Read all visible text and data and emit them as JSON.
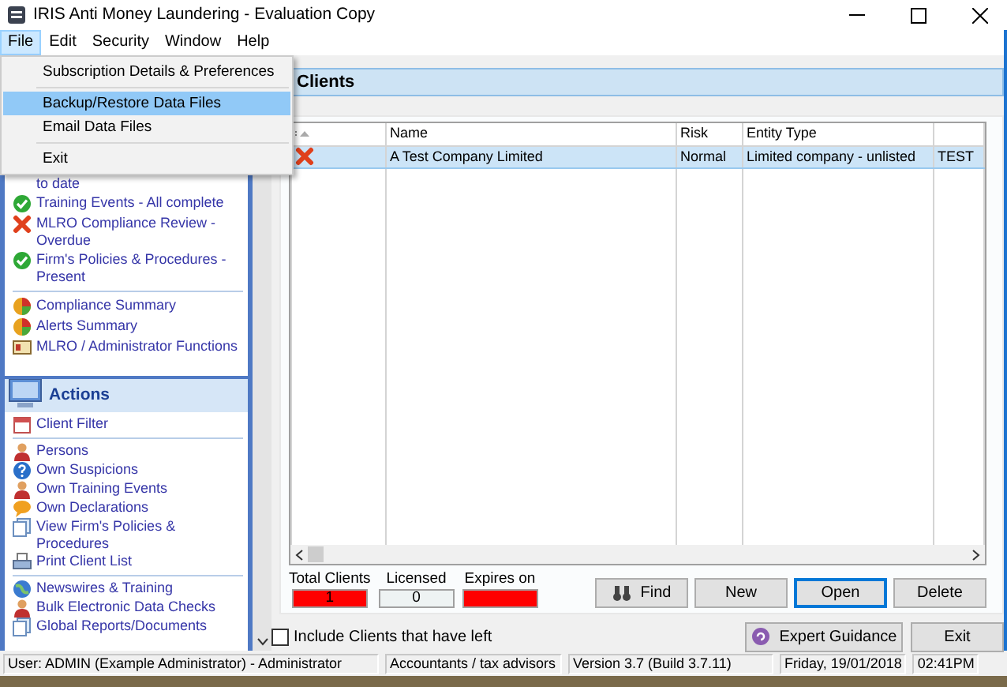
{
  "window": {
    "title": "IRIS Anti Money Laundering - Evaluation Copy"
  },
  "menu_bar": [
    {
      "label": "File",
      "selected": true
    },
    {
      "label": "Edit",
      "selected": false
    },
    {
      "label": "Security",
      "selected": false
    },
    {
      "label": "Window",
      "selected": false
    },
    {
      "label": "Help",
      "selected": false
    }
  ],
  "file_menu": [
    {
      "kind": "item",
      "label": "Subscription Details & Preferences",
      "selected": false
    },
    {
      "kind": "separator"
    },
    {
      "kind": "item",
      "label": "Backup/Restore Data Files",
      "selected": true
    },
    {
      "kind": "item",
      "label": "Email Data Files",
      "selected": false
    },
    {
      "kind": "separator"
    },
    {
      "kind": "item",
      "label": "Exit",
      "selected": false
    }
  ],
  "status_panel": {
    "items": [
      {
        "kind": "plain",
        "label": "to date"
      },
      {
        "kind": "check",
        "label": "Training Events - All complete"
      },
      {
        "kind": "cross",
        "label": "MLRO Compliance Review - Overdue"
      },
      {
        "kind": "check",
        "label": "Firm's Policies & Procedures - Present"
      },
      {
        "kind": "separator"
      },
      {
        "kind": "chart",
        "label": "Compliance Summary"
      },
      {
        "kind": "chart",
        "label": "Alerts Summary"
      },
      {
        "kind": "card",
        "label": "MLRO / Administrator Functions"
      }
    ]
  },
  "actions_panel": {
    "title": "Actions",
    "items": [
      {
        "kind": "calendar",
        "label": "Client Filter"
      },
      {
        "kind": "separator"
      },
      {
        "kind": "person",
        "label": "Persons"
      },
      {
        "kind": "help",
        "label": "Own Suspicions"
      },
      {
        "kind": "person",
        "label": "Own Training Events"
      },
      {
        "kind": "speech",
        "label": "Own Declarations"
      },
      {
        "kind": "pages",
        "label": "View Firm's Policies & Procedures"
      },
      {
        "kind": "printer",
        "label": "Print Client List"
      },
      {
        "kind": "separator"
      },
      {
        "kind": "globe",
        "label": "Newswires & Training"
      },
      {
        "kind": "person",
        "label": "Bulk Electronic Data Checks"
      },
      {
        "kind": "pages",
        "label": "Global Reports/Documents"
      }
    ]
  },
  "clients": {
    "title": "Clients",
    "table": {
      "columns": [
        {
          "kind": "sort"
        },
        {
          "kind": "text",
          "label": "Name"
        },
        {
          "kind": "text",
          "label": "Risk"
        },
        {
          "kind": "text",
          "label": "Entity Type"
        },
        {
          "kind": "blank"
        }
      ],
      "rows": [
        {
          "selected": true,
          "flagged": true,
          "cells": [
            "",
            "A Test Company Limited",
            "Normal",
            "Limited company - unlisted",
            "TEST"
          ]
        }
      ]
    },
    "counters": [
      {
        "label": "Total Clients",
        "value": "1",
        "alert": true
      },
      {
        "label": "Licensed",
        "value": "0",
        "alert": false
      },
      {
        "label": "Expires on",
        "alert": true
      }
    ],
    "buttons": [
      {
        "label": "Find",
        "kind": "binoculars",
        "default": false
      },
      {
        "label": "New",
        "kind": "plain",
        "default": false
      },
      {
        "label": "Open",
        "kind": "plain",
        "default": true
      },
      {
        "label": "Delete",
        "kind": "plain",
        "default": false
      }
    ]
  },
  "include_left": {
    "label": "Include Clients that have left",
    "checked": false
  },
  "footer_buttons": [
    {
      "label": "Expert Guidance",
      "kind": "guidance"
    },
    {
      "label": "Exit",
      "kind": "plain"
    }
  ],
  "status_bar": [
    "User: ADMIN (Example Administrator) - Administrator",
    "Accountants / tax advisors",
    "Version 3.7 (Build 3.7.11)",
    "Friday, 19/01/2018",
    "02:41PM"
  ]
}
